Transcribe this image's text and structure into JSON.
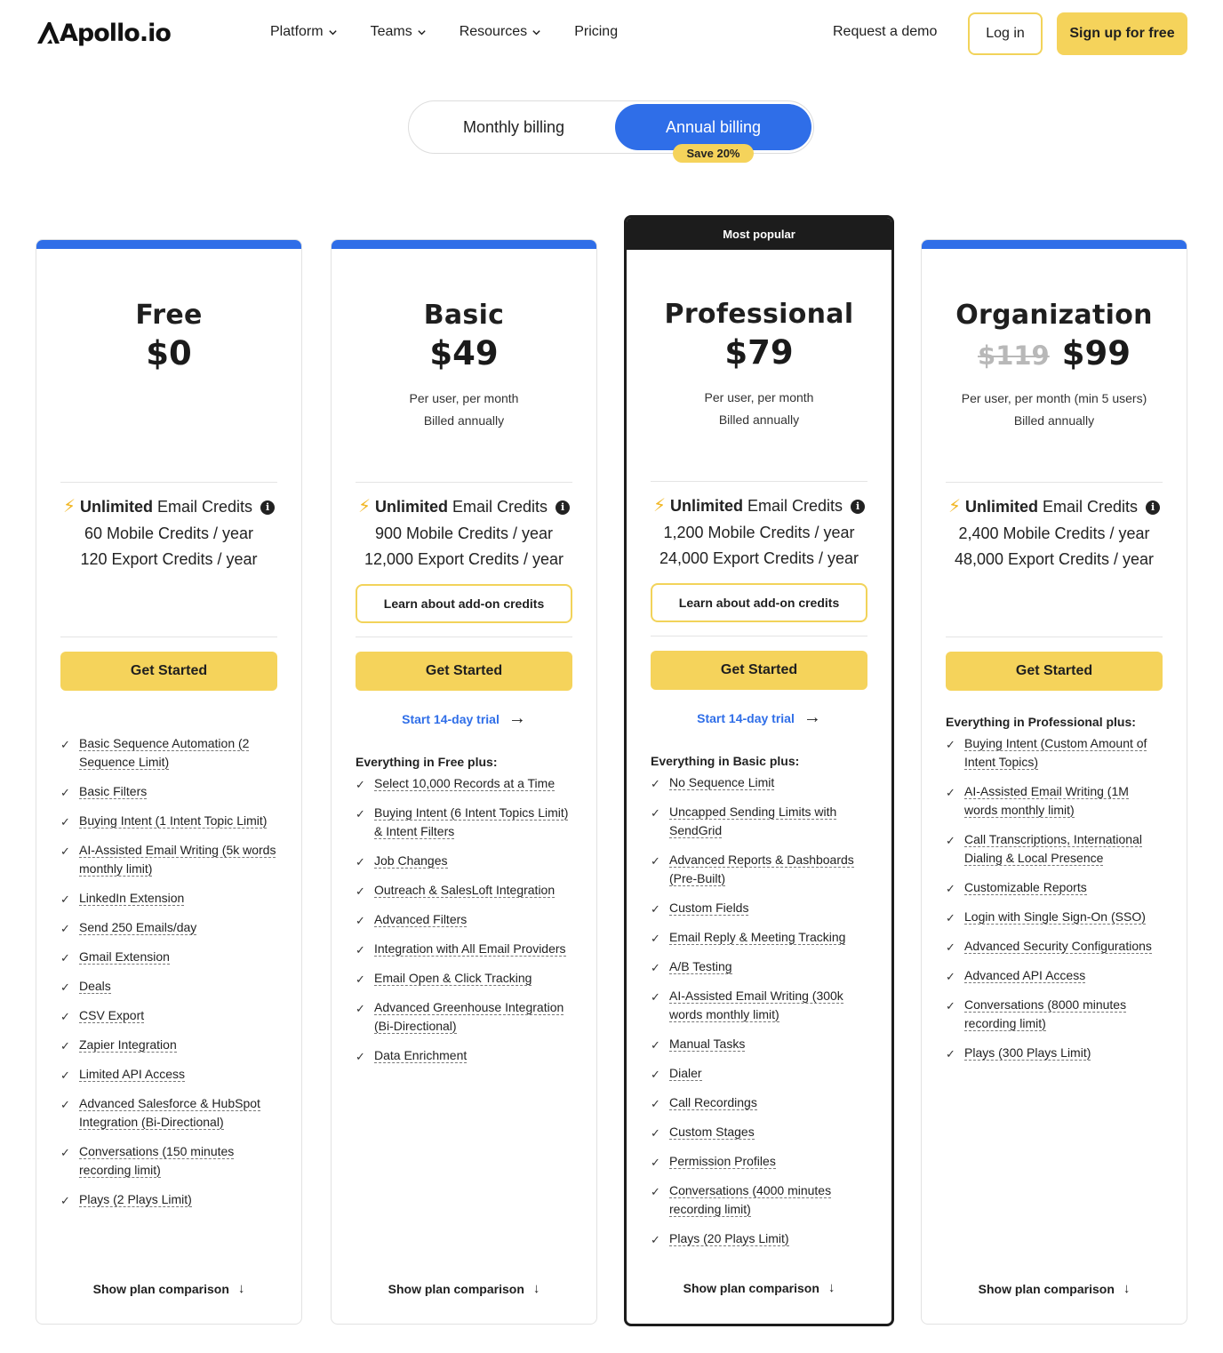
{
  "nav": {
    "logo": "Apollo.io",
    "links": [
      "Platform",
      "Teams",
      "Resources",
      "Pricing"
    ],
    "request_demo": "Request a demo",
    "login": "Log in",
    "signup": "Sign up for free"
  },
  "billing": {
    "monthly": "Monthly billing",
    "annual": "Annual billing",
    "selected": "Annual billing",
    "save_badge": "Save 20%"
  },
  "colors": {
    "brand_blue": "#2f6ee8",
    "brand_yellow": "#f5d35b",
    "popular_dark": "#1c1c1c"
  },
  "plans": [
    {
      "name": "Free",
      "price": "$0",
      "note1": "",
      "note2": "",
      "credits_bold": "Unlimited",
      "credits_rest": "Email Credits",
      "mobile": "60 Mobile Credits / year",
      "export": "120 Export Credits / year",
      "cta": "Get Started",
      "features_heading": "",
      "features": [
        "Basic Sequence Automation (2 Sequence Limit)",
        "Basic Filters",
        "Buying Intent (1 Intent Topic Limit)",
        "AI-Assisted Email Writing (5k words monthly limit)",
        "LinkedIn Extension",
        "Send 250 Emails/day",
        "Gmail Extension",
        "Deals",
        "CSV Export",
        "Zapier Integration",
        "Limited API Access",
        "Advanced Salesforce & HubSpot Integration (Bi-Directional)",
        "Conversations (150 minutes recording limit)",
        "Plays (2 Plays Limit)"
      ],
      "compare": "Show plan comparison"
    },
    {
      "name": "Basic",
      "price": "$49",
      "note1": "Per user, per month",
      "note2": "Billed annually",
      "credits_bold": "Unlimited",
      "credits_rest": "Email Credits",
      "mobile": "900 Mobile Credits / year",
      "export": "12,000 Export Credits / year",
      "addon": "Learn about add-on credits",
      "cta": "Get Started",
      "trial": "Start 14-day trial",
      "features_heading": "Everything in Free plus:",
      "features": [
        "Select 10,000 Records at a Time",
        "Buying Intent (6 Intent Topics Limit) & Intent Filters",
        "Job Changes",
        "Outreach & SalesLoft Integration",
        "Advanced Filters",
        "Integration with All Email Providers",
        "Email Open & Click Tracking",
        "Advanced Greenhouse Integration (Bi-Directional)",
        "Data Enrichment"
      ],
      "compare": "Show plan comparison"
    },
    {
      "name": "Professional",
      "badge": "Most popular",
      "price": "$79",
      "note1": "Per user, per month",
      "note2": "Billed annually",
      "credits_bold": "Unlimited",
      "credits_rest": "Email Credits",
      "mobile": "1,200 Mobile Credits / year",
      "export": "24,000 Export Credits / year",
      "addon": "Learn about add-on credits",
      "cta": "Get Started",
      "trial": "Start 14-day trial",
      "features_heading": "Everything in Basic plus:",
      "features": [
        "No Sequence Limit",
        "Uncapped Sending Limits with SendGrid",
        "Advanced Reports & Dashboards (Pre-Built)",
        "Custom Fields",
        "Email Reply & Meeting Tracking",
        "A/B Testing",
        "AI-Assisted Email Writing (300k words monthly limit)",
        "Manual Tasks",
        "Dialer",
        "Call Recordings",
        "Custom Stages",
        "Permission Profiles",
        "Conversations (4000 minutes recording limit)",
        "Plays (20 Plays Limit)"
      ],
      "compare": "Show plan comparison"
    },
    {
      "name": "Organization",
      "old_price": "$119",
      "price": "$99",
      "note1": "Per user, per month (min 5 users)",
      "note2": "Billed annually",
      "credits_bold": "Unlimited",
      "credits_rest": "Email Credits",
      "mobile": "2,400 Mobile Credits / year",
      "export": "48,000 Export Credits / year",
      "cta": "Get Started",
      "features_heading": "Everything in Professional plus:",
      "features": [
        "Buying Intent (Custom Amount of Intent Topics)",
        "AI-Assisted Email Writing (1M words monthly limit)",
        "Call Transcriptions, International Dialing & Local Presence",
        "Customizable Reports",
        "Login with Single Sign-On (SSO)",
        "Advanced Security Configurations",
        "Advanced API Access",
        "Conversations (8000 minutes recording limit)",
        "Plays (300 Plays Limit)"
      ],
      "compare": "Show plan comparison"
    }
  ]
}
